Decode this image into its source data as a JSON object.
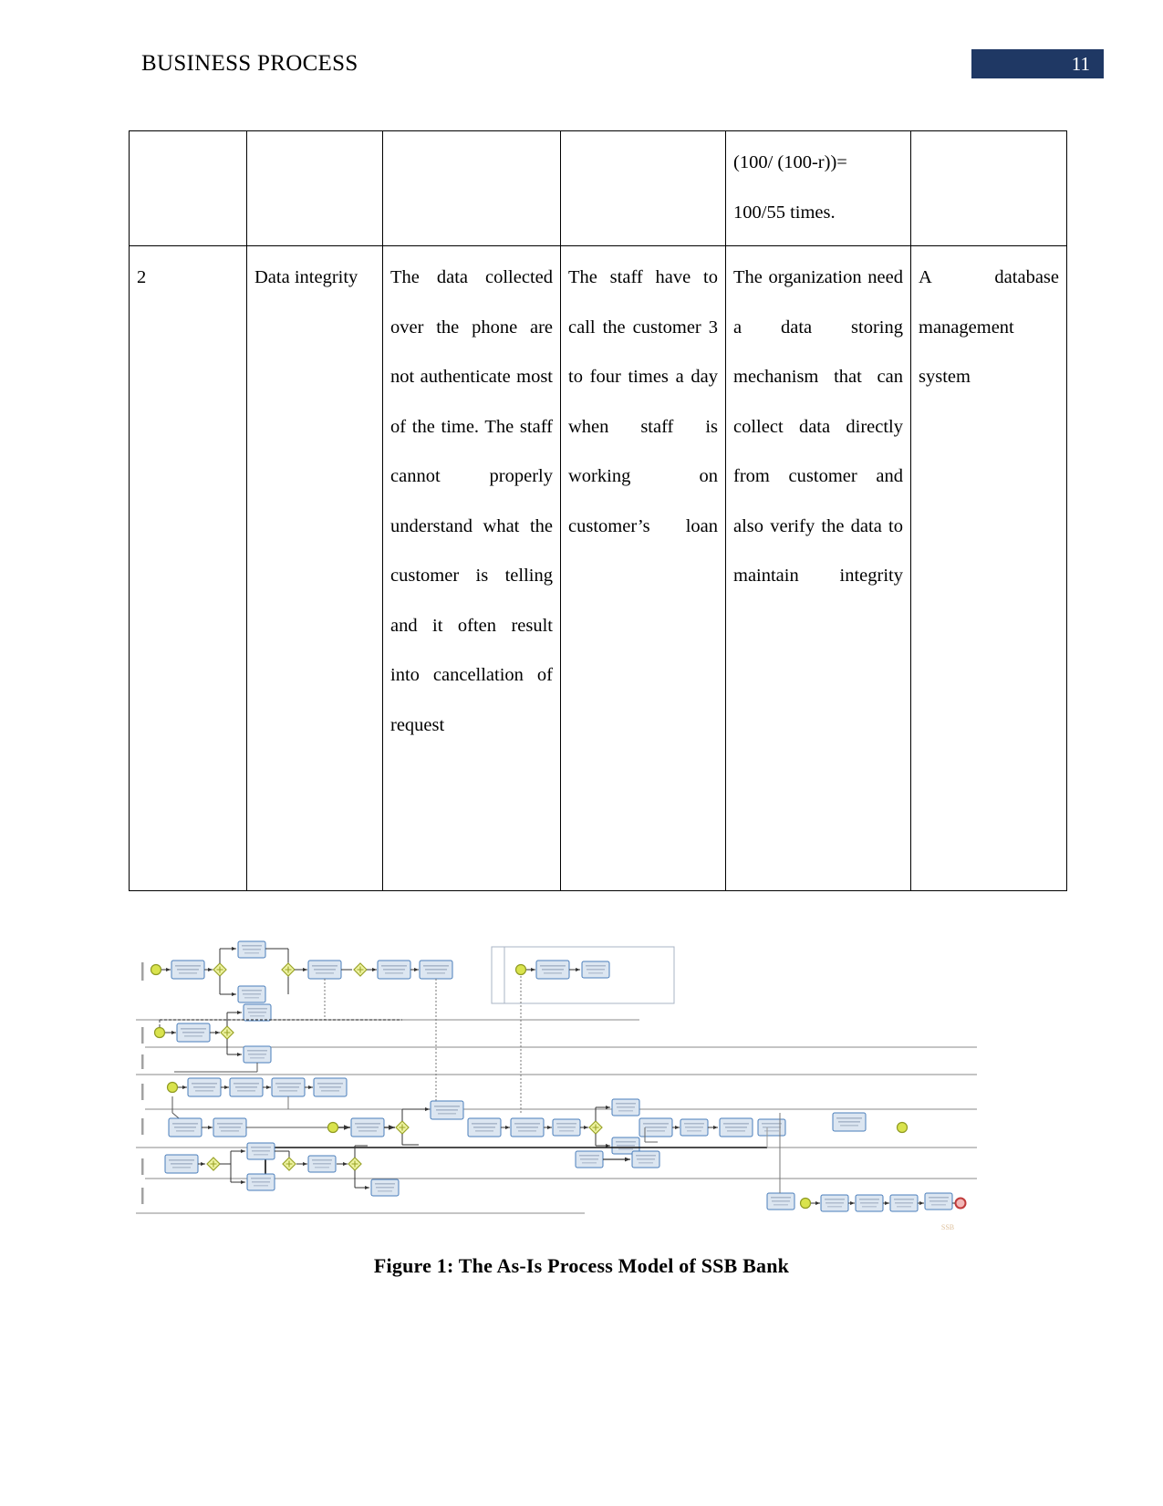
{
  "header": {
    "title": "BUSINESS PROCESS",
    "page_number": "11",
    "badge_color": "#1F3864"
  },
  "table": {
    "rows": [
      {
        "cells": [
          {
            "text": ""
          },
          {
            "text": ""
          },
          {
            "text": ""
          },
          {
            "text": ""
          },
          {
            "text": "(100/     (100-r))=\n\n100/55 times."
          },
          {
            "text": ""
          }
        ]
      },
      {
        "cells": [
          {
            "text": "2"
          },
          {
            "text": "Data integrity"
          },
          {
            "text": "The data collected over the phone are not authenticate most of the time. The staff cannot properly understand what the customer is telling and it often result into cancellation of request"
          },
          {
            "text": "The staff have to call the customer 3 to four times a day when staff is working on customer’s loan"
          },
          {
            "text": "The organization need a data storing mechanism that can collect data directly from customer and also verify the data to maintain integrity"
          },
          {
            "text": "A database management system"
          }
        ]
      }
    ],
    "row1_col5_line1": "(100/     (100-r))=",
    "row1_col5_line2": "100/55 times.",
    "row2_col1": "2",
    "row2_col2": "Data integrity",
    "row2_col3": "The data collected over the phone are not authenticate most of the time. The staff cannot properly understand what the customer is telling and it often result into cancellation of request",
    "row2_col4": "The staff have to call the customer 3 to four times a day when staff is working on customer’s loan",
    "row2_col5": "The organization need a data storing mechanism that can collect data directly from customer and also verify the data to maintain integrity",
    "row2_col6": "A database management system"
  },
  "figure": {
    "caption": "Figure 1: The As-Is Process Model of SSB Bank",
    "alt": "BPMN as-is process model diagram with swimlanes",
    "colors": {
      "task_fill": "#dce6f1",
      "task_stroke": "#4a7ebb",
      "event_fill": "#d7e04a",
      "event_stroke": "#8a9a1f",
      "gateway_fill": "#e8ee8a",
      "gateway_stroke": "#8a9a1f",
      "lane_line": "#808080",
      "flow_line": "#404040",
      "end_event": "#cc3333",
      "watermark": "#c8a27a"
    },
    "watermark": "SSB"
  }
}
